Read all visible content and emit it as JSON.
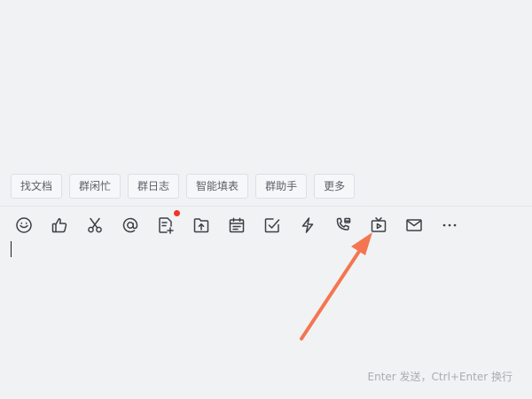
{
  "quick_actions": [
    {
      "label": "找文档"
    },
    {
      "label": "群闲忙"
    },
    {
      "label": "群日志"
    },
    {
      "label": "智能填表"
    },
    {
      "label": "群助手"
    },
    {
      "label": "更多"
    }
  ],
  "toolbar": {
    "icons": [
      "emoji-icon",
      "thumbs-up-icon",
      "scissors-icon",
      "at-icon",
      "doc-add-icon",
      "folder-upload-icon",
      "calendar-icon",
      "checkbox-icon",
      "lightning-icon",
      "phone-call-icon",
      "tv-play-icon",
      "mail-icon",
      "more-icon"
    ],
    "badge_on": "doc-add-icon"
  },
  "composer": {
    "hint": "Enter 发送，Ctrl+Enter 换行"
  },
  "colors": {
    "background": "#f1f2f4",
    "arrow": "#f47650",
    "badge": "#f0352b"
  }
}
